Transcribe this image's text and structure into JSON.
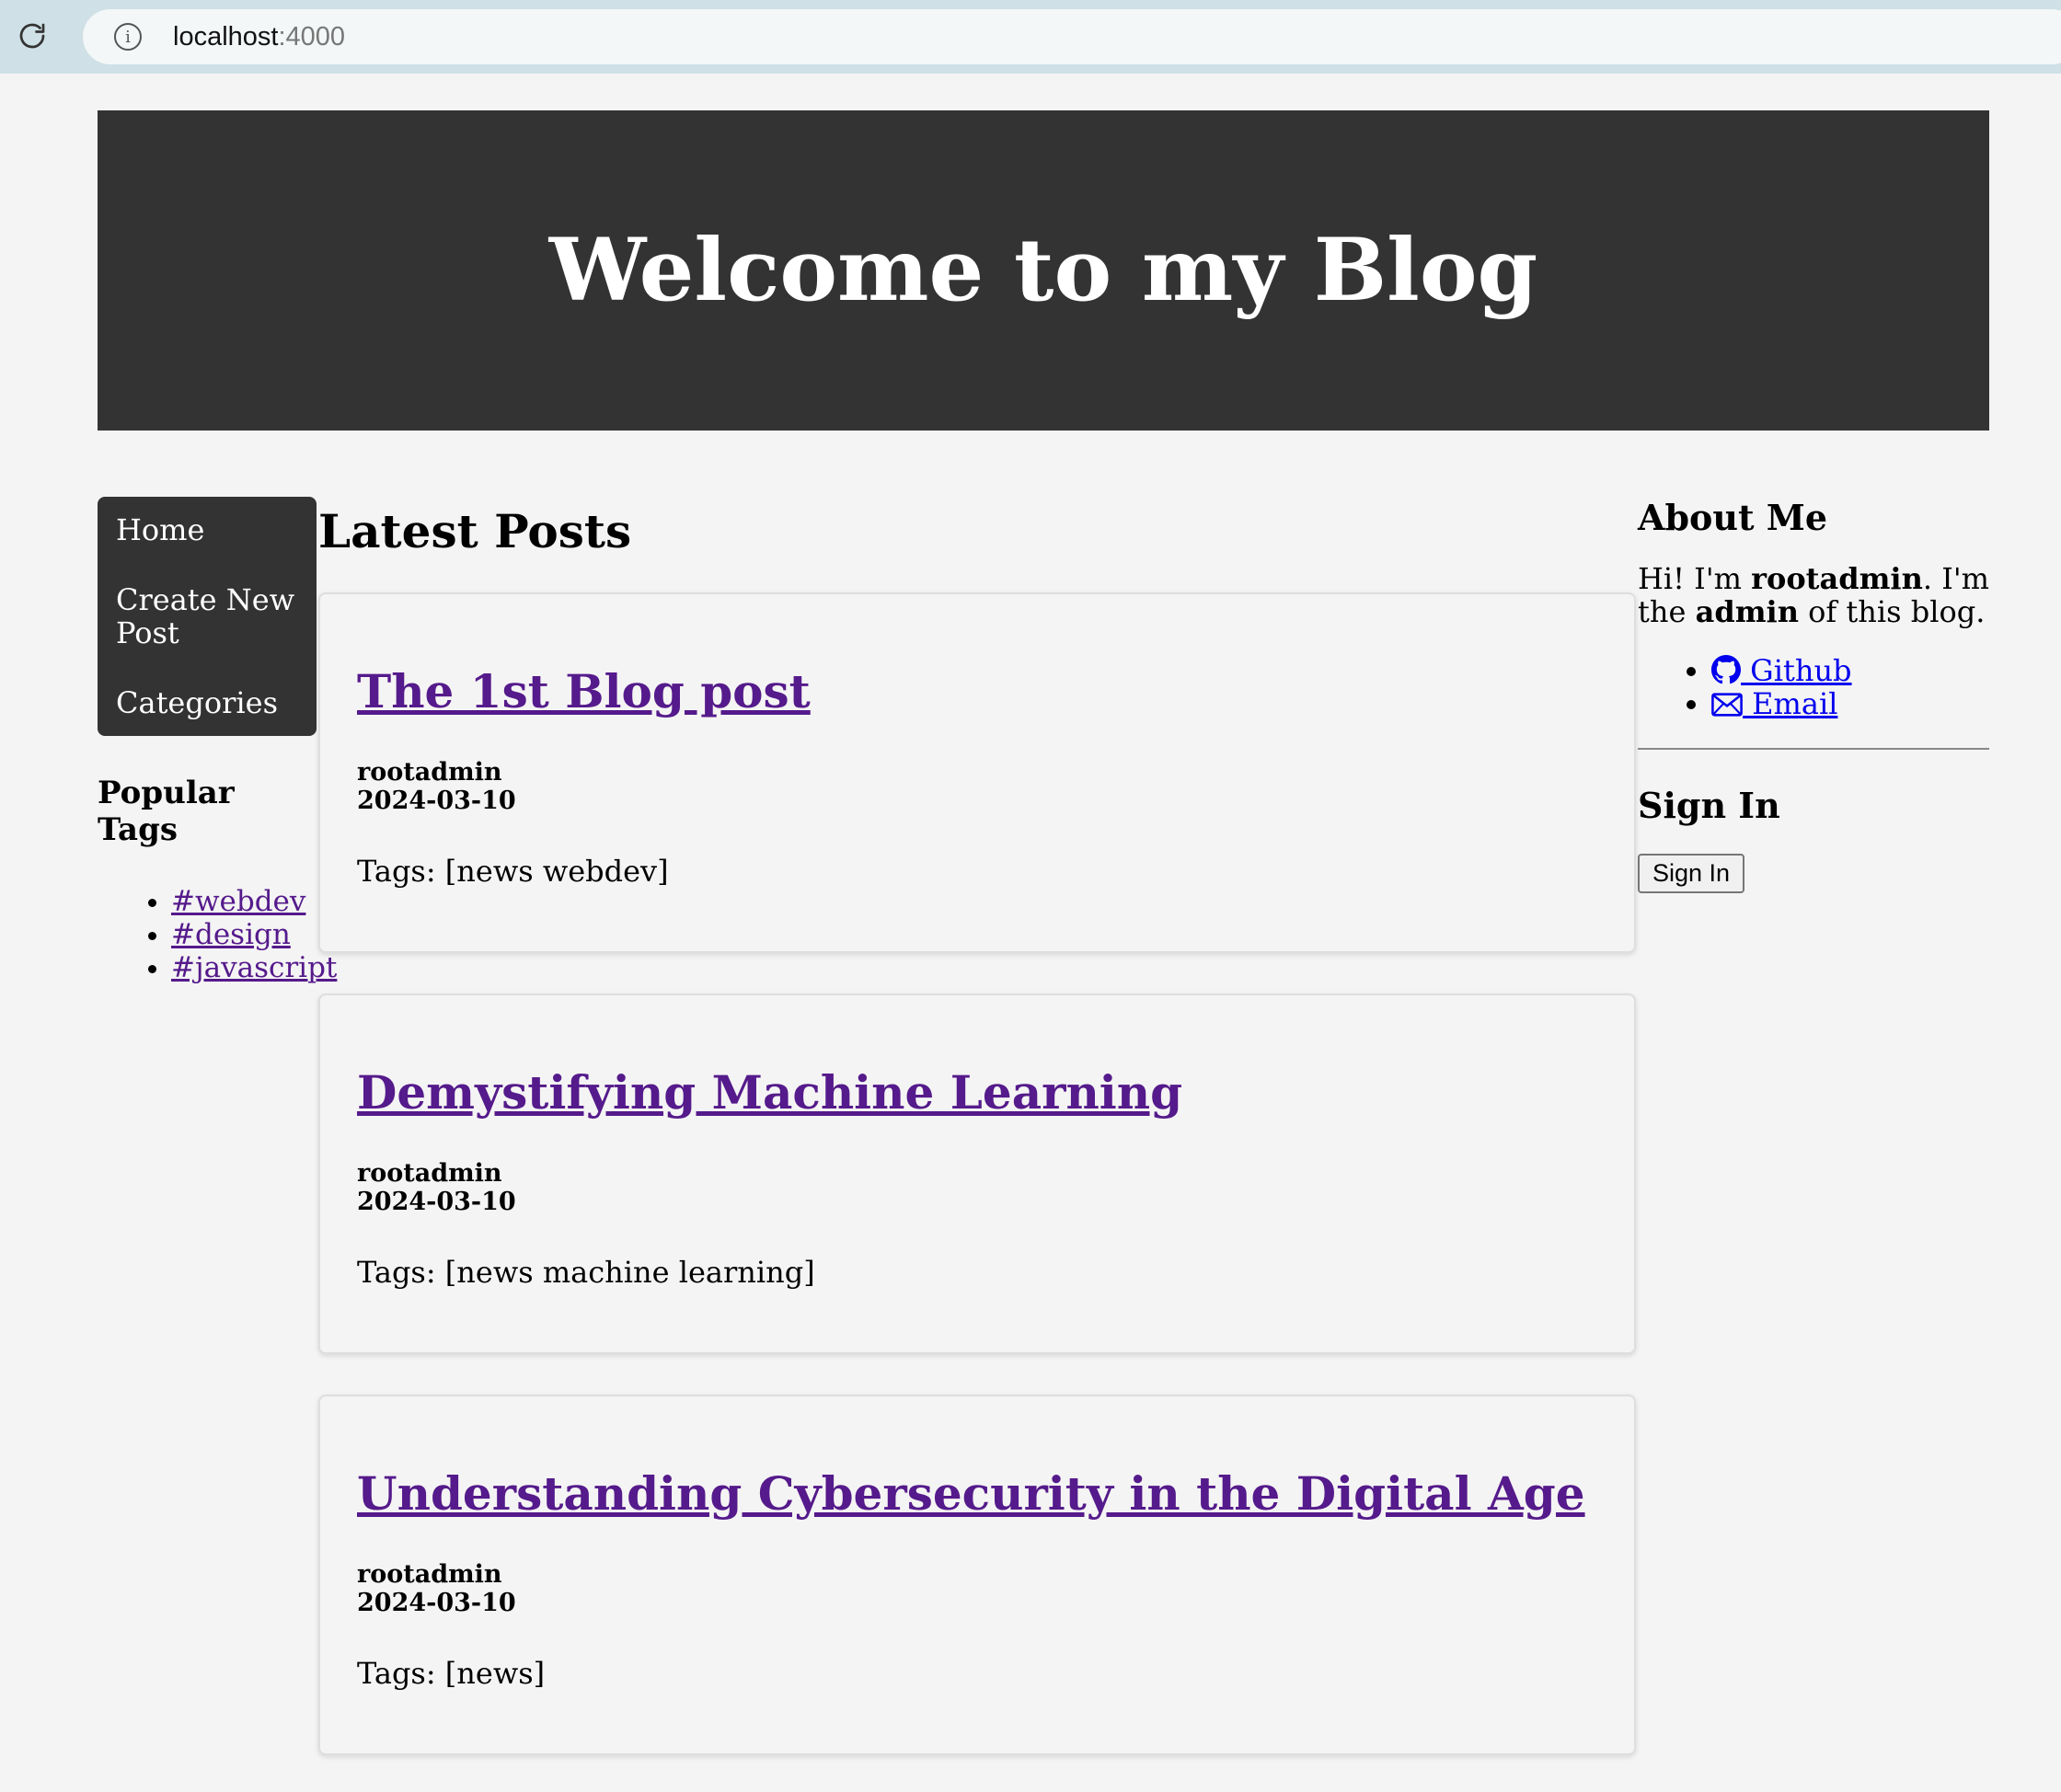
{
  "browser": {
    "url_host": "localhost",
    "url_port": ":4000"
  },
  "header": {
    "title": "Welcome to my Blog"
  },
  "nav": {
    "items": [
      {
        "label": "Home"
      },
      {
        "label": "Create New Post"
      },
      {
        "label": "Categories"
      }
    ]
  },
  "popular_tags": {
    "heading": "Popular Tags",
    "tags": [
      "#webdev",
      "#design",
      "#javascript"
    ]
  },
  "main": {
    "heading": "Latest Posts",
    "posts": [
      {
        "title": "The 1st Blog post",
        "author": "rootadmin",
        "date": "2024-03-10",
        "tags": "Tags: [news webdev]"
      },
      {
        "title": "Demystifying Machine Learning",
        "author": "rootadmin",
        "date": "2024-03-10",
        "tags": "Tags: [news machine learning]"
      },
      {
        "title": "Understanding Cybersecurity in the Digital Age",
        "author": "rootadmin",
        "date": "2024-03-10",
        "tags": "Tags: [news]"
      }
    ]
  },
  "about": {
    "heading": "About Me",
    "text_1": "Hi! I'm ",
    "username": "rootadmin",
    "text_2": ". I'm the ",
    "role": "admin",
    "text_3": " of this blog.",
    "links": [
      {
        "label": " Github",
        "icon": "github-icon"
      },
      {
        "label": " Email",
        "icon": "mail-icon"
      }
    ]
  },
  "signin": {
    "heading": "Sign In",
    "button_label": "Sign In"
  },
  "colors": {
    "header_bg": "#333333",
    "page_bg": "#f4f4f4",
    "visited_link": "#551a8b",
    "link": "#0000ee"
  }
}
